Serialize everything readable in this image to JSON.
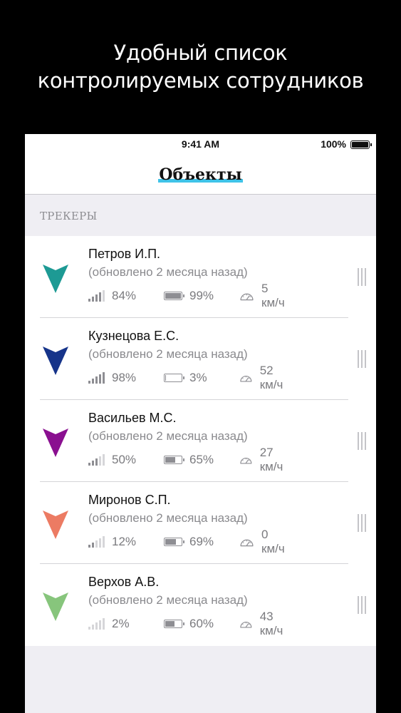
{
  "promo": {
    "line1": "Удобный список",
    "line2": "контролируемых сотрудников"
  },
  "status_bar": {
    "time": "9:41 AM",
    "battery": "100%"
  },
  "nav": {
    "title": "Объекты"
  },
  "section": {
    "title": "ТРЕКЕРЫ"
  },
  "trackers": [
    {
      "name": "Петров И.П.",
      "updated": "(обновлено 2 месяца назад)",
      "signal": "84%",
      "signal_bars": 4,
      "battery": "99%",
      "battery_level": 0.99,
      "speed": "5 км/ч",
      "color": "#1d9a94"
    },
    {
      "name": "Кузнецова Е.С.",
      "updated": "(обновлено 2 месяца назад)",
      "signal": "98%",
      "signal_bars": 5,
      "battery": "3%",
      "battery_level": 0.03,
      "speed": "52 км/ч",
      "color": "#16348a"
    },
    {
      "name": "Васильев М.С.",
      "updated": "(обновлено 2 месяца назад)",
      "signal": "50%",
      "signal_bars": 3,
      "battery": "65%",
      "battery_level": 0.65,
      "speed": "27 км/ч",
      "color": "#8a1090"
    },
    {
      "name": "Миронов С.П.",
      "updated": "(обновлено 2 месяца назад)",
      "signal": "12%",
      "signal_bars": 2,
      "battery": "69%",
      "battery_level": 0.69,
      "speed": "0 км/ч",
      "color": "#ec7b63"
    },
    {
      "name": "Верхов А.В.",
      "updated": "(обновлено 2 месяца назад)",
      "signal": "2%",
      "signal_bars": 0,
      "battery": "60%",
      "battery_level": 0.6,
      "speed": "43 км/ч",
      "color": "#87c57c"
    }
  ],
  "icons": {
    "signal": "signal-bars-icon",
    "battery": "battery-icon",
    "speed": "speedometer-icon",
    "marker": "direction-arrow-icon",
    "reorder": "reorder-handle-icon"
  }
}
